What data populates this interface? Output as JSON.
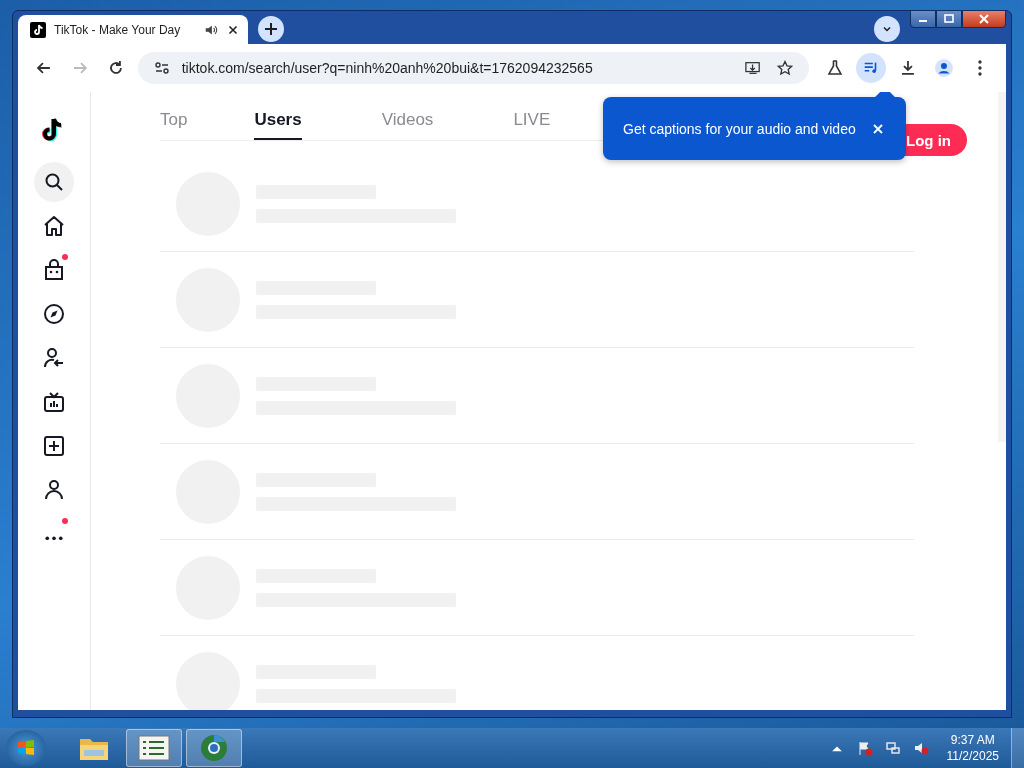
{
  "browser": {
    "tab": {
      "title": "TikTok - Make Your Day",
      "playing_audio": true
    },
    "url": "tiktok.com/search/user?q=ninh%20anh%20bui&t=1762094232565"
  },
  "sidebar": {
    "items": [
      {
        "kind": "search",
        "badge": false
      },
      {
        "kind": "home",
        "badge": false
      },
      {
        "kind": "shop",
        "badge": true
      },
      {
        "kind": "explore",
        "badge": false
      },
      {
        "kind": "following",
        "badge": false
      },
      {
        "kind": "live",
        "badge": false
      },
      {
        "kind": "upload",
        "badge": false
      },
      {
        "kind": "profile",
        "badge": false
      },
      {
        "kind": "more",
        "badge": true
      }
    ]
  },
  "search_tabs": [
    {
      "label": "Top",
      "selected": false
    },
    {
      "label": "Users",
      "selected": true
    },
    {
      "label": "Videos",
      "selected": false
    },
    {
      "label": "LIVE",
      "selected": false
    }
  ],
  "login_button": "Log in",
  "popup": {
    "text": "Get captions for your audio and video"
  },
  "results": [
    {
      "kind": "skeleton"
    },
    {
      "kind": "skeleton"
    },
    {
      "kind": "skeleton"
    },
    {
      "kind": "skeleton"
    },
    {
      "kind": "skeleton"
    },
    {
      "kind": "skeleton"
    }
  ],
  "taskbar": {
    "time": "9:37 AM",
    "date": "11/2/2025"
  }
}
